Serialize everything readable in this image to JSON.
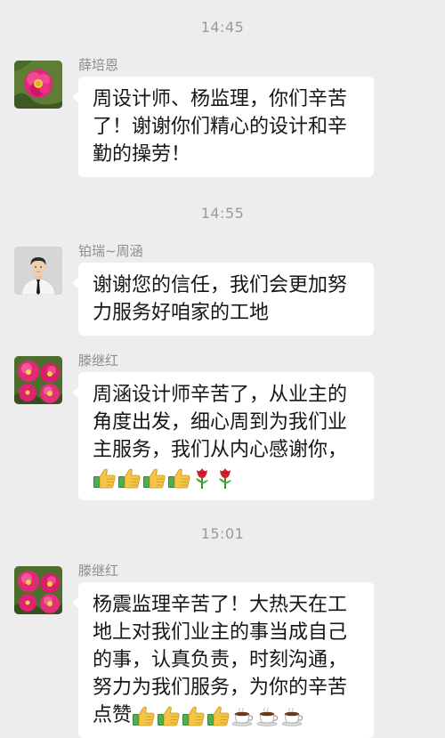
{
  "timestamps": [
    "14:45",
    "14:55",
    "15:01"
  ],
  "messages": [
    {
      "sender": "薛培恩",
      "avatar_icon": "peony-flower-avatar",
      "text": "周设计师、杨监理，你们辛苦了！谢谢你们精心的设计和辛勤的操劳！"
    },
    {
      "sender": "铂瑞~周涵",
      "avatar_icon": "person-portrait-avatar",
      "text": "谢谢您的信任，我们会更加努力服务好咱家的工地"
    },
    {
      "sender": "滕继红",
      "avatar_icon": "peony-flower-avatar",
      "text": "周涵设计师辛苦了，从业主的角度出发，细心周到为我们业主服务，我们从内心感谢你，",
      "emojis": [
        "thumbs-up",
        "thumbs-up",
        "thumbs-up",
        "thumbs-up",
        "rose",
        "rose"
      ]
    },
    {
      "sender": "滕继红",
      "avatar_icon": "peony-flower-avatar",
      "text": "杨震监理辛苦了！大热天在工地上对我们业主的事当成自己的事，认真负责，时刻沟通，努力为我们服务，为你的辛苦点赞",
      "emojis": [
        "thumbs-up",
        "thumbs-up",
        "thumbs-up",
        "thumbs-up",
        "coffee",
        "coffee",
        "coffee"
      ]
    }
  ],
  "colors": {
    "background": "#ededed",
    "bubble": "#ffffff",
    "timestamp": "#9a9a9a",
    "sender": "#8e8e8e"
  }
}
